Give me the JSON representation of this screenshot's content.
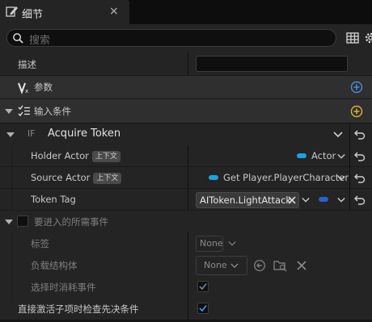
{
  "tab": {
    "title": "细节",
    "close": "×"
  },
  "search": {
    "placeholder": "搜索"
  },
  "rows": {
    "description": {
      "label": "描述",
      "value": ""
    },
    "params": {
      "label": "参数"
    },
    "input_conditions": {
      "label": "输入条件"
    },
    "condition": {
      "prefix": "IF",
      "title": "Acquire Token"
    },
    "holder_actor": {
      "label": "Holder Actor",
      "badge": "上下文",
      "value": "Actor"
    },
    "source_actor": {
      "label": "Source Actor",
      "badge": "上下文",
      "value": "Get Player.PlayerCharacter"
    },
    "token_tag": {
      "label": "Token Tag",
      "value": "AIToken.LightAttack"
    },
    "required_events": {
      "label": "要进入的所需事件"
    },
    "tag": {
      "label": "标签",
      "value": "None"
    },
    "payload": {
      "label": "负载结构体",
      "value": "None"
    },
    "consume_on_select": {
      "label": "选择时消耗事件",
      "checked": true
    },
    "check_prereq": {
      "label": "直接激活子项时检查先决条件",
      "checked": true
    }
  },
  "colors": {
    "accent_blue": "#1ba1e2",
    "add_blue": "#4a8cd8",
    "add_yellow": "#d7b53a",
    "background": "#242424"
  },
  "icons": [
    "details-icon",
    "close-icon",
    "search-icon",
    "grid-icon",
    "gear-icon",
    "variable-icon",
    "add-icon",
    "condition-list-icon",
    "reset-arrow-icon",
    "chevron-down-icon",
    "browse-icon",
    "use-selected-icon",
    "clear-icon",
    "check-icon"
  ]
}
